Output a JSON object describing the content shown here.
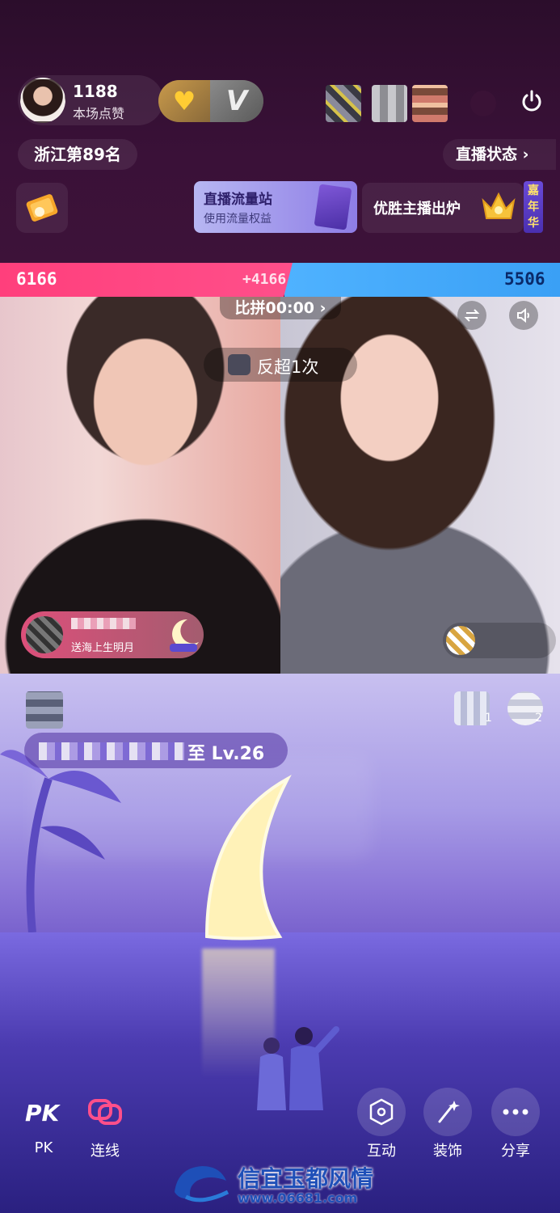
{
  "header": {
    "likes_count": "1188",
    "likes_label": "本场点赞",
    "rank_label": "浙江第89名",
    "status_label": "直播状态 ›",
    "power_icon": "power-icon"
  },
  "banners": {
    "traffic_title": "直播流量站",
    "traffic_sub": "使用流量权益",
    "winner_text": "优胜主播出炉",
    "carnival_tag": "嘉年华"
  },
  "pk": {
    "left_score": "6166",
    "diff": "+4166",
    "right_score": "5506",
    "timer": "比拼00:00 ›",
    "overtake": "反超1次",
    "left_color": "#ff3f7c",
    "right_color": "#3aa0f5"
  },
  "gift": {
    "text": "送海上生明月"
  },
  "feed": {
    "levelup_text": "至 Lv.26",
    "rank_1": "1",
    "rank_2": "2"
  },
  "toolbar": {
    "pk_label": "PK",
    "link_label": "连线",
    "interact_label": "互动",
    "deco_label": "装饰",
    "share_label": "分享"
  },
  "watermark": {
    "title": "信宜玉都风情",
    "url": "www.06681.com"
  }
}
